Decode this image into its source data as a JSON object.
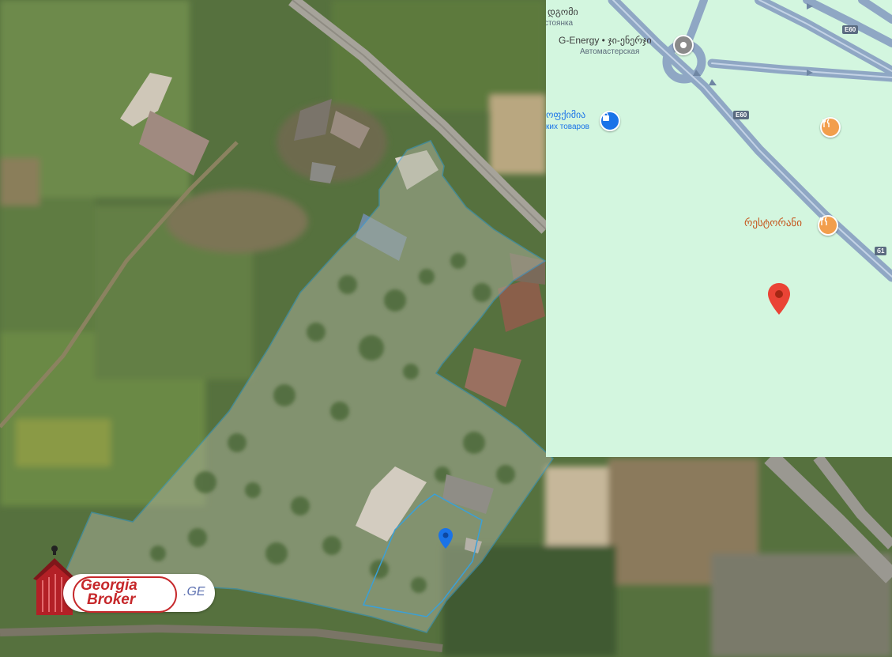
{
  "satellite": {
    "parcel_marker_icon": "location-pin-icon",
    "parcel_outline_color": "#3aa0d8",
    "marker_color": "#1a73e8"
  },
  "map": {
    "labels": {
      "parking_top": "დგომი",
      "parking_sub": "стоянка",
      "gas_station": "G-Energy • ჯი-ენერჯი",
      "gas_station_sub": "Автомастерская",
      "shop": "ოფქიმია",
      "shop_sub": "ких товаров",
      "restaurant": "რესტორანი"
    },
    "road_shields": [
      "E60",
      "E60",
      "б1"
    ],
    "icons": {
      "gas_station": "gas-station-icon",
      "shop": "shopping-bag-icon",
      "restaurant_a": "fork-knife-icon",
      "restaurant_b": "fork-knife-icon",
      "selected_pin": "red-map-pin-icon"
    },
    "colors": {
      "background": "#d3f6df",
      "road": "#8fa7c4",
      "pin": "#ea4335",
      "restaurant": "#f29e4c"
    }
  },
  "logo": {
    "line1": "Georgia",
    "line2": "Broker",
    "tld": ".GE",
    "color": "#c6282b"
  }
}
